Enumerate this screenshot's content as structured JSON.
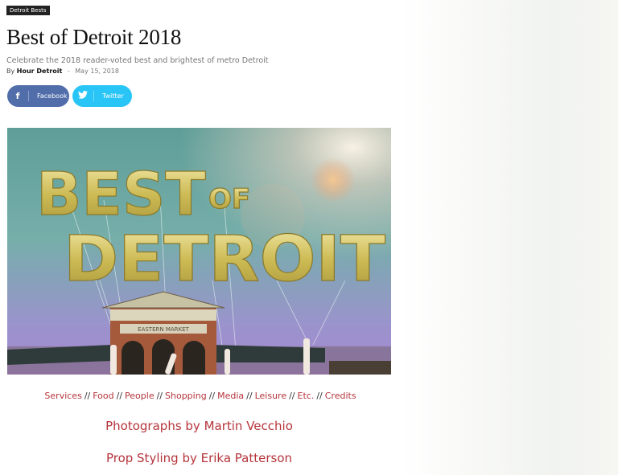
{
  "category": "Detroit Bests",
  "article": {
    "title": "Best of Detroit 2018",
    "subtitle": "Celebrate the 2018 reader-voted best and brightest of metro Detroit",
    "by_label": "By",
    "author": "Hour Detroit",
    "separator": "-",
    "date": "May 15, 2018"
  },
  "share": {
    "facebook_label": "Facebook",
    "twitter_label": "Twitter"
  },
  "hero": {
    "balloon_text_1": "BEST",
    "balloon_text_2": "OF",
    "balloon_text_3": "DETROIT",
    "building_sign": "EASTERN MARKET",
    "colors": {
      "sky_top": "#6fa8a0",
      "sky_bottom": "#a48ad0",
      "balloon": "#d9c76a",
      "building": "#a65a3c"
    }
  },
  "sections": {
    "divider": "//",
    "links": [
      "Services",
      "Food",
      "People",
      "Shopping",
      "Media",
      "Leisure",
      "Etc.",
      "Credits"
    ]
  },
  "credits": {
    "photographs": "Photographs by Martin Vecchio",
    "styling": "Prop Styling by Erika Patterson"
  },
  "colors": {
    "accent": "#b5343b",
    "facebook": "#516eab",
    "twitter": "#29c5f6"
  }
}
